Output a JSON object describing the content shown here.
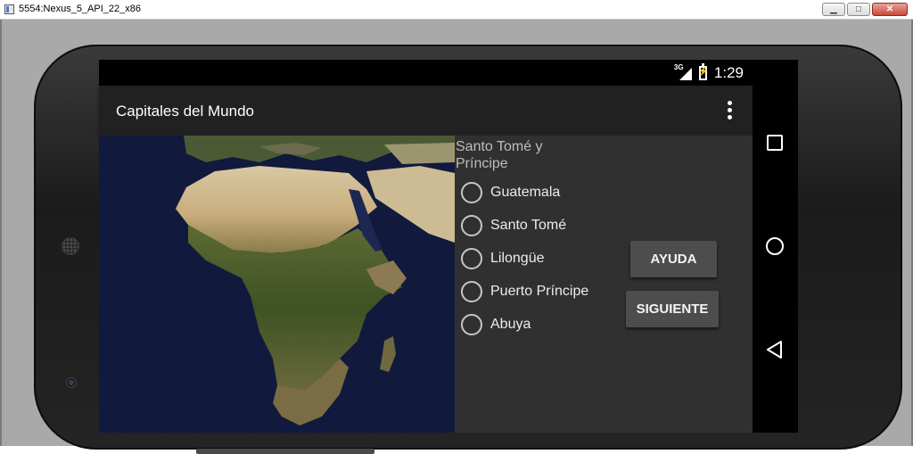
{
  "window": {
    "title": "5554:Nexus_5_API_22_x86",
    "buttons": {
      "minimize": "▁",
      "maximize": "□",
      "close": "✕"
    }
  },
  "statusbar": {
    "network": "3G",
    "time": "1:29"
  },
  "appbar": {
    "title": "Capitales del Mundo"
  },
  "quiz": {
    "question": "Santo Tomé y Príncipe",
    "options": [
      {
        "label": "Guatemala"
      },
      {
        "label": "Santo Tomé"
      },
      {
        "label": "Lilongüe"
      },
      {
        "label": "Puerto Príncipe"
      },
      {
        "label": "Abuya"
      }
    ]
  },
  "buttons": {
    "help_label": "AYUDA",
    "next_label": "SIGUIENTE"
  },
  "navbar": {
    "recent_icon": "square-icon",
    "home_icon": "circle-icon",
    "back_icon": "triangle-back-icon"
  },
  "colors": {
    "appbar": "#212121",
    "content": "#303030",
    "button": "#4d4d4d",
    "ocean": "#111a3c"
  }
}
